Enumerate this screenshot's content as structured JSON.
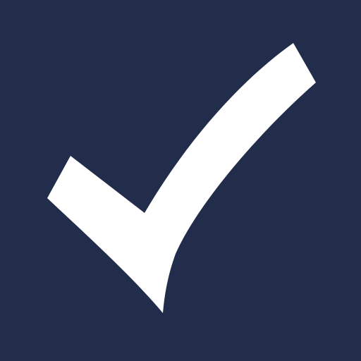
{
  "icon": {
    "name": "checkmark-icon",
    "background_color": "#212d4a",
    "foreground_color": "#ffffff"
  }
}
